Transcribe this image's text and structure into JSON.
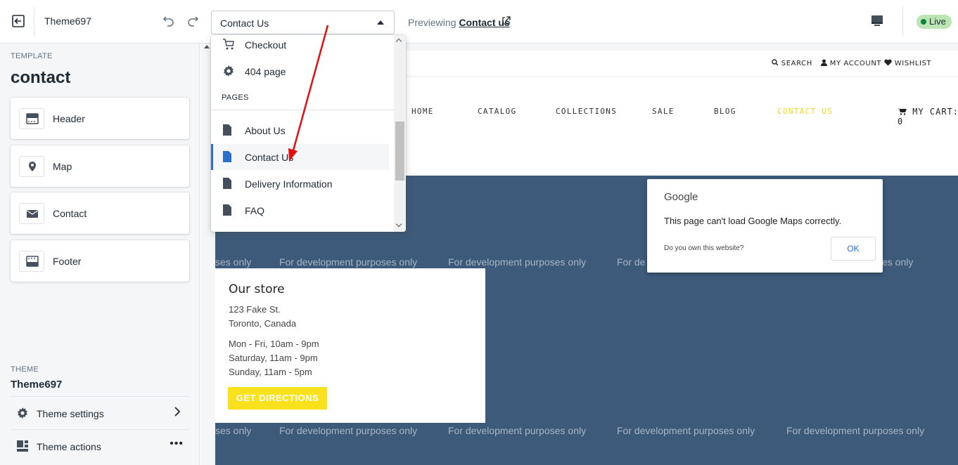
{
  "topbar": {
    "theme_name": "Theme697",
    "page_selector_value": "Contact Us",
    "previewing_prefix": "Previewing",
    "previewing_link": "Contact us",
    "live_badge": "Live"
  },
  "dropdown": {
    "items_top": [
      {
        "label": "Checkout",
        "icon": "cart-icon"
      },
      {
        "label": "404 page",
        "icon": "gear-icon"
      }
    ],
    "pages_heading": "PAGES",
    "pages": [
      {
        "label": "About Us",
        "icon": "page-icon",
        "selected": false
      },
      {
        "label": "Contact Us",
        "icon": "page-icon",
        "selected": true
      },
      {
        "label": "Delivery Information",
        "icon": "page-icon",
        "selected": false
      },
      {
        "label": "FAQ",
        "icon": "page-icon",
        "selected": false
      }
    ]
  },
  "sidebar": {
    "template_label": "TEMPLATE",
    "template_name": "contact",
    "sections": [
      {
        "label": "Header",
        "icon": "header-icon"
      },
      {
        "label": "Map",
        "icon": "map-pin-icon"
      },
      {
        "label": "Contact",
        "icon": "envelope-icon"
      },
      {
        "label": "Footer",
        "icon": "footer-icon"
      }
    ],
    "theme_label": "THEME",
    "theme_name": "Theme697",
    "theme_settings": "Theme settings",
    "theme_actions": "Theme actions",
    "theme_actions_more": "•••"
  },
  "site": {
    "utility": {
      "search": "SEARCH",
      "account": "MY ACCOUNT",
      "wishlist": "WISHLIST"
    },
    "nav": [
      "HOME",
      "CATALOG",
      "COLLECTIONS",
      "SALE",
      "BLOG",
      "CONTACT US"
    ],
    "nav_active": "CONTACT US",
    "cart": "MY CART: 0",
    "map_watermark": "For development purposes only",
    "map_watermark_partial_left": "ses only",
    "map_watermark_partial_mid": "For de",
    "map_watermark_partial_right": "es only",
    "store": {
      "heading": "Our store",
      "address_line1": "123 Fake St.",
      "address_line2": "Toronto, Canada",
      "hours1": "Mon - Fri, 10am - 9pm",
      "hours2": "Saturday, 11am - 9pm",
      "hours3": "Sunday, 11am - 5pm",
      "button": "GET DIRECTIONS"
    },
    "google_dialog": {
      "brand": "Google",
      "message": "This page can't load Google Maps correctly.",
      "question": "Do you own this website?",
      "ok": "OK"
    }
  },
  "colors": {
    "accent_yellow": "#f9e21d",
    "map_blue": "#3d5a7a",
    "selection_blue": "#2c6ecb",
    "live_green": "#bbe5b3",
    "annotation_red": "#e01010"
  }
}
